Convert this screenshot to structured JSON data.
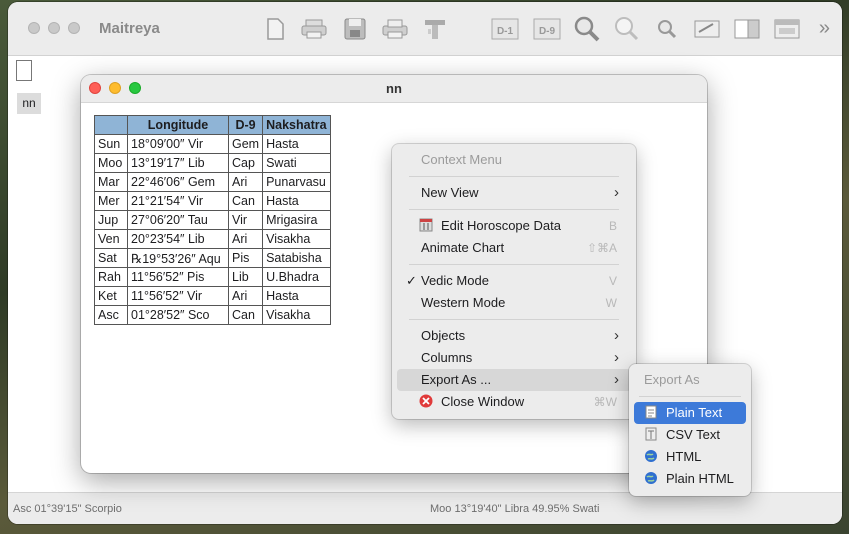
{
  "app": {
    "title": "Maitreya",
    "toolbar_more": "»",
    "side_label": "nn",
    "status_left": "Asc 01°39'15\" Scorpio",
    "status_center": "Moo 13°19'40\" Libra 49.95% Swati"
  },
  "toolbar_icons": [
    "new-document-icon",
    "print-icon",
    "save-icon",
    "print-preview-icon",
    "graphic-chart-icon",
    "d1-chart-icon",
    "d9-chart-icon",
    "search-icon",
    "zoom-icon",
    "find-icon",
    "edit-icon",
    "view-icon",
    "window-icon"
  ],
  "child": {
    "title": "nn",
    "table": {
      "headers": [
        "",
        "Longitude",
        "D-9",
        "Nakshatra"
      ],
      "rows": [
        [
          "Sun",
          "18°09′00″ Vir",
          "Gem",
          "Hasta"
        ],
        [
          "Moo",
          "13°19′17″ Lib",
          "Cap",
          "Swati"
        ],
        [
          "Mar",
          "22°46′06″ Gem",
          "Ari",
          "Punarvasu"
        ],
        [
          "Mer",
          "21°21′54″ Vir",
          "Can",
          "Hasta"
        ],
        [
          "Jup",
          "27°06′20″ Tau",
          "Vir",
          "Mrigasira"
        ],
        [
          "Ven",
          "20°23′54″ Lib",
          "Ari",
          "Visakha"
        ],
        [
          "Sat",
          "℞19°53′26″ Aqu",
          "Pis",
          "Satabisha"
        ],
        [
          "Rah",
          "11°56′52″ Pis",
          "Lib",
          "U.Bhadra"
        ],
        [
          "Ket",
          "11°56′52″ Vir",
          "Ari",
          "Hasta"
        ],
        [
          "Asc",
          "01°28′52″ Sco",
          "Can",
          "Visakha"
        ]
      ]
    }
  },
  "context_menu": {
    "header": "Context Menu",
    "new_view": "New View",
    "edit_data": "Edit Horoscope Data",
    "edit_data_sc": "B",
    "animate": "Animate Chart",
    "animate_sc": "⇧⌘A",
    "vedic": "Vedic Mode",
    "vedic_sc": "V",
    "western": "Western Mode",
    "western_sc": "W",
    "objects": "Objects",
    "columns": "Columns",
    "export_as": "Export As ...",
    "close": "Close Window",
    "close_sc": "⌘W"
  },
  "export_menu": {
    "header": "Export As",
    "items": [
      "Plain Text",
      "CSV Text",
      "HTML",
      "Plain HTML"
    ]
  }
}
